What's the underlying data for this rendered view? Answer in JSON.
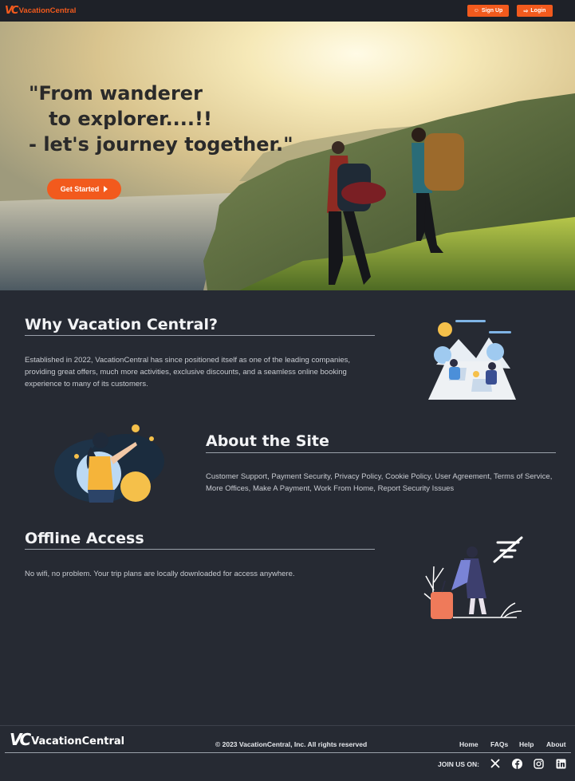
{
  "nav": {
    "logo_mark": "VC",
    "logo_name": "VacationCentral",
    "signup_label": "Sign Up",
    "login_label": "Login",
    "signup_icon": "person-plus-icon",
    "login_icon": "login-icon"
  },
  "hero": {
    "quote": "\"From wanderer\n   to explorer....!!\n- let's journey together.\"",
    "cta_label": "Get Started"
  },
  "why": {
    "title": "Why Vacation Central?",
    "text": "Established in 2022, VacationCentral has since positioned itself as one of the leading companies, providing great offers, much more activities, exclusive discounts, and a seamless online booking experience to many of its customers."
  },
  "about": {
    "title": "About the Site",
    "text": "Customer Support, Payment Security, Privacy Policy, Cookie Policy, User Agreement, Terms of Service, More Offices, Make A Payment, Work From Home, Report Security Issues"
  },
  "offline": {
    "title": "Offline Access",
    "text": "No wifi, no problem. Your trip plans are locally downloaded for access anywhere."
  },
  "footer": {
    "logo_mark": "VC",
    "logo_name": "VacationCentral",
    "copyright": "© 2023 VacationCentral, Inc. All rights reserved",
    "links": [
      "Home",
      "FAQs",
      "Help",
      "About"
    ],
    "join_label": "JOIN US ON:",
    "socials": [
      "x-icon",
      "facebook-icon",
      "instagram-icon",
      "linkedin-icon"
    ]
  },
  "colors": {
    "accent": "#f25a1d",
    "background": "#262a33",
    "topbar": "#1e2128"
  }
}
